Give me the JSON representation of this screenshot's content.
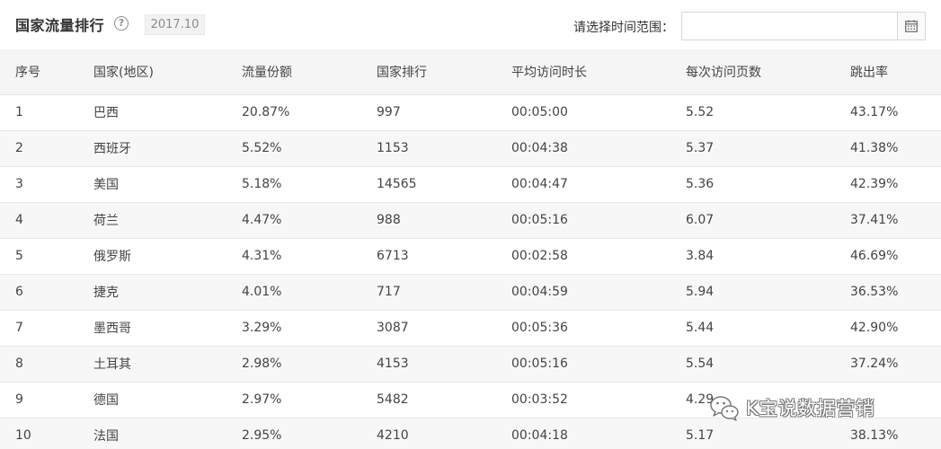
{
  "header": {
    "title": "国家流量排行",
    "help_icon": "question-circle-icon",
    "period_badge": "2017.10",
    "range_label": "请选择时间范围：",
    "range_value": "",
    "range_placeholder": "",
    "calendar_icon": "calendar-icon"
  },
  "table": {
    "columns": [
      "序号",
      "国家(地区)",
      "流量份额",
      "国家排行",
      "平均访问时长",
      "每次访问页数",
      "跳出率"
    ],
    "rows": [
      [
        "1",
        "巴西",
        "20.87%",
        "997",
        "00:05:00",
        "5.52",
        "43.17%"
      ],
      [
        "2",
        "西班牙",
        "5.52%",
        "1153",
        "00:04:38",
        "5.37",
        "41.38%"
      ],
      [
        "3",
        "美国",
        "5.18%",
        "14565",
        "00:04:47",
        "5.36",
        "42.39%"
      ],
      [
        "4",
        "荷兰",
        "4.47%",
        "988",
        "00:05:16",
        "6.07",
        "37.41%"
      ],
      [
        "5",
        "俄罗斯",
        "4.31%",
        "6713",
        "00:02:58",
        "3.84",
        "46.69%"
      ],
      [
        "6",
        "捷克",
        "4.01%",
        "717",
        "00:04:59",
        "5.94",
        "36.53%"
      ],
      [
        "7",
        "墨西哥",
        "3.29%",
        "3087",
        "00:05:36",
        "5.44",
        "42.90%"
      ],
      [
        "8",
        "土耳其",
        "2.98%",
        "4153",
        "00:05:16",
        "5.54",
        "37.24%"
      ],
      [
        "9",
        "德国",
        "2.97%",
        "5482",
        "00:03:52",
        "4.29",
        ""
      ],
      [
        "10",
        "法国",
        "2.95%",
        "4210",
        "00:04:18",
        "5.17",
        "38.13%"
      ]
    ]
  },
  "watermark": {
    "text": "K宝说数据营销",
    "icon": "wechat-icon"
  }
}
